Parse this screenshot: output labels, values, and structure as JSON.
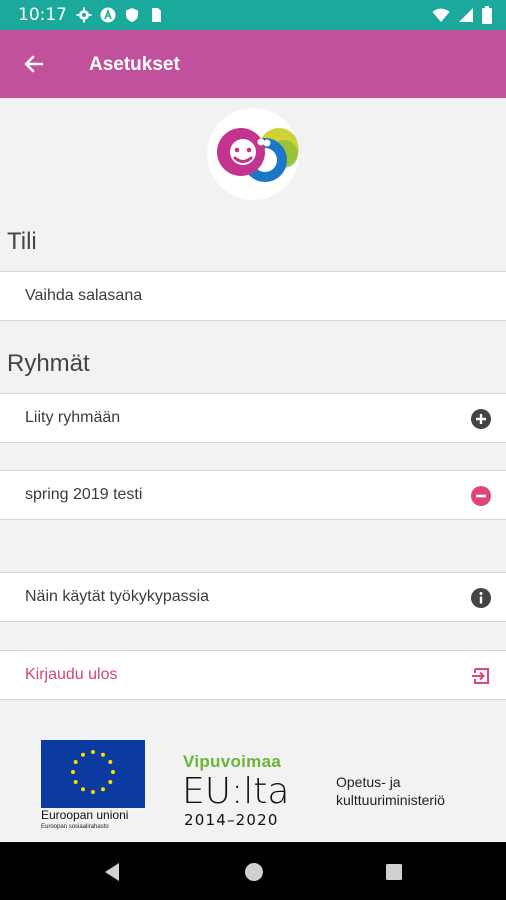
{
  "status_bar": {
    "time": "10:17",
    "left_icons": [
      "gear-icon",
      "a-icon",
      "shield-icon",
      "sim-icon"
    ],
    "right_icons": [
      "wifi-icon",
      "signal-icon",
      "battery-icon"
    ],
    "color": "#1aa99a"
  },
  "app_bar": {
    "title": "Asetukset",
    "back_icon": "arrow-left-icon",
    "color": "#c2519b"
  },
  "sections": {
    "account_title": "Tili",
    "groups_title": "Ryhmät"
  },
  "rows": {
    "change_password": "Vaihda salasana",
    "join_group": "Liity ryhmään",
    "group_item": "spring 2019 testi",
    "how_to_use": "Näin käytät työkykypassia",
    "logout": "Kirjaudu ulos"
  },
  "icons": {
    "join_group": "plus-circle-icon",
    "group_item": "minus-circle-icon",
    "how_to_use": "info-icon",
    "logout": "logout-icon"
  },
  "footer": {
    "eu_name": "Euroopan unioni",
    "eu_fund": "Euroopan sosiaalirahasto",
    "vipuvoimaa": "Vipuvoimaa",
    "eulta": "EU:lta",
    "years": "2014–2020",
    "ministry_line1": "Opetus- ja",
    "ministry_line2": "kulttuuriministeriö"
  },
  "colors": {
    "accent": "#c2519b",
    "danger": "#e0447f",
    "text": "#3c3c3c"
  }
}
